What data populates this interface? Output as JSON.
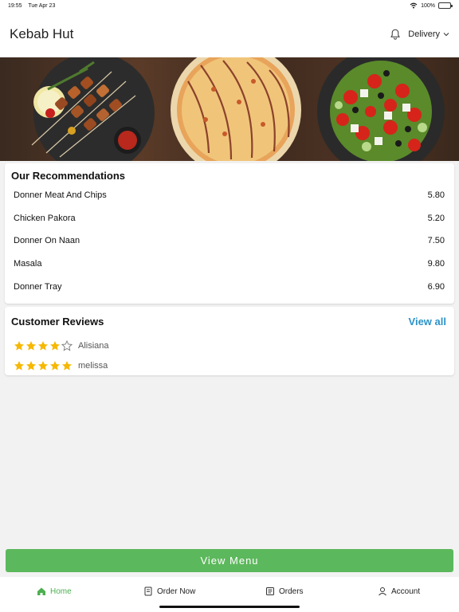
{
  "status_bar": {
    "time": "19:55",
    "date": "Tue Apr 23",
    "battery": "100%",
    "battery_level": 1.0
  },
  "header": {
    "title": "Kebab Hut",
    "delivery_label": "Delivery"
  },
  "recommendations": {
    "title": "Our Recommendations",
    "items": [
      {
        "name": "Donner Meat And Chips",
        "price": "5.80"
      },
      {
        "name": "Chicken Pakora",
        "price": "5.20"
      },
      {
        "name": "Donner On Naan",
        "price": "7.50"
      },
      {
        "name": "Masala",
        "price": "9.80"
      },
      {
        "name": "Donner Tray",
        "price": "6.90"
      }
    ]
  },
  "reviews": {
    "title": "Customer Reviews",
    "view_all": "View all",
    "items": [
      {
        "name": "Alisiana",
        "rating": 4
      },
      {
        "name": "melissa",
        "rating": 5
      }
    ]
  },
  "view_menu_label": "View Menu",
  "tabs": [
    {
      "label": "Home",
      "icon": "home-icon",
      "active": true
    },
    {
      "label": "Order Now",
      "icon": "order-icon",
      "active": false
    },
    {
      "label": "Orders",
      "icon": "receipt-icon",
      "active": false
    },
    {
      "label": "Account",
      "icon": "user-icon",
      "active": false
    }
  ],
  "colors": {
    "accent_green": "#5cb85c",
    "link_blue": "#2b93c8",
    "star_yellow": "#f6b800"
  }
}
